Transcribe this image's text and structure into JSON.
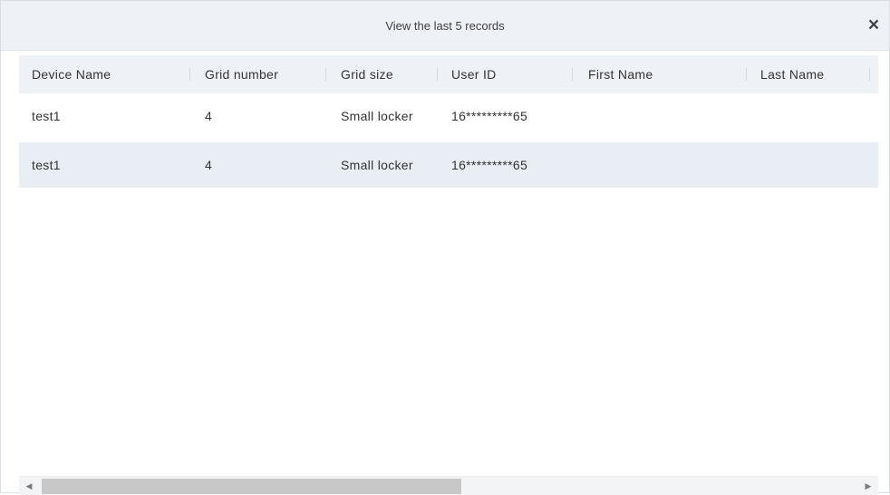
{
  "dialog": {
    "title": "View the last 5 records",
    "close_icon": "close-icon"
  },
  "table": {
    "columns": [
      {
        "label": "Device Name"
      },
      {
        "label": "Grid number"
      },
      {
        "label": "Grid size"
      },
      {
        "label": "User ID"
      },
      {
        "label": "First Name"
      },
      {
        "label": "Last Name"
      }
    ],
    "rows": [
      {
        "device": "test1",
        "grid_number": "4",
        "grid_size": "Small locker",
        "user_id": "16*********65",
        "first_name": "",
        "last_name": ""
      },
      {
        "device": "test1",
        "grid_number": "4",
        "grid_size": "Small locker",
        "user_id": "16*********65",
        "first_name": "",
        "last_name": ""
      }
    ]
  },
  "scrollbar": {
    "left_icon": "scroll-left-arrow-icon",
    "right_icon": "scroll-right-arrow-icon"
  }
}
